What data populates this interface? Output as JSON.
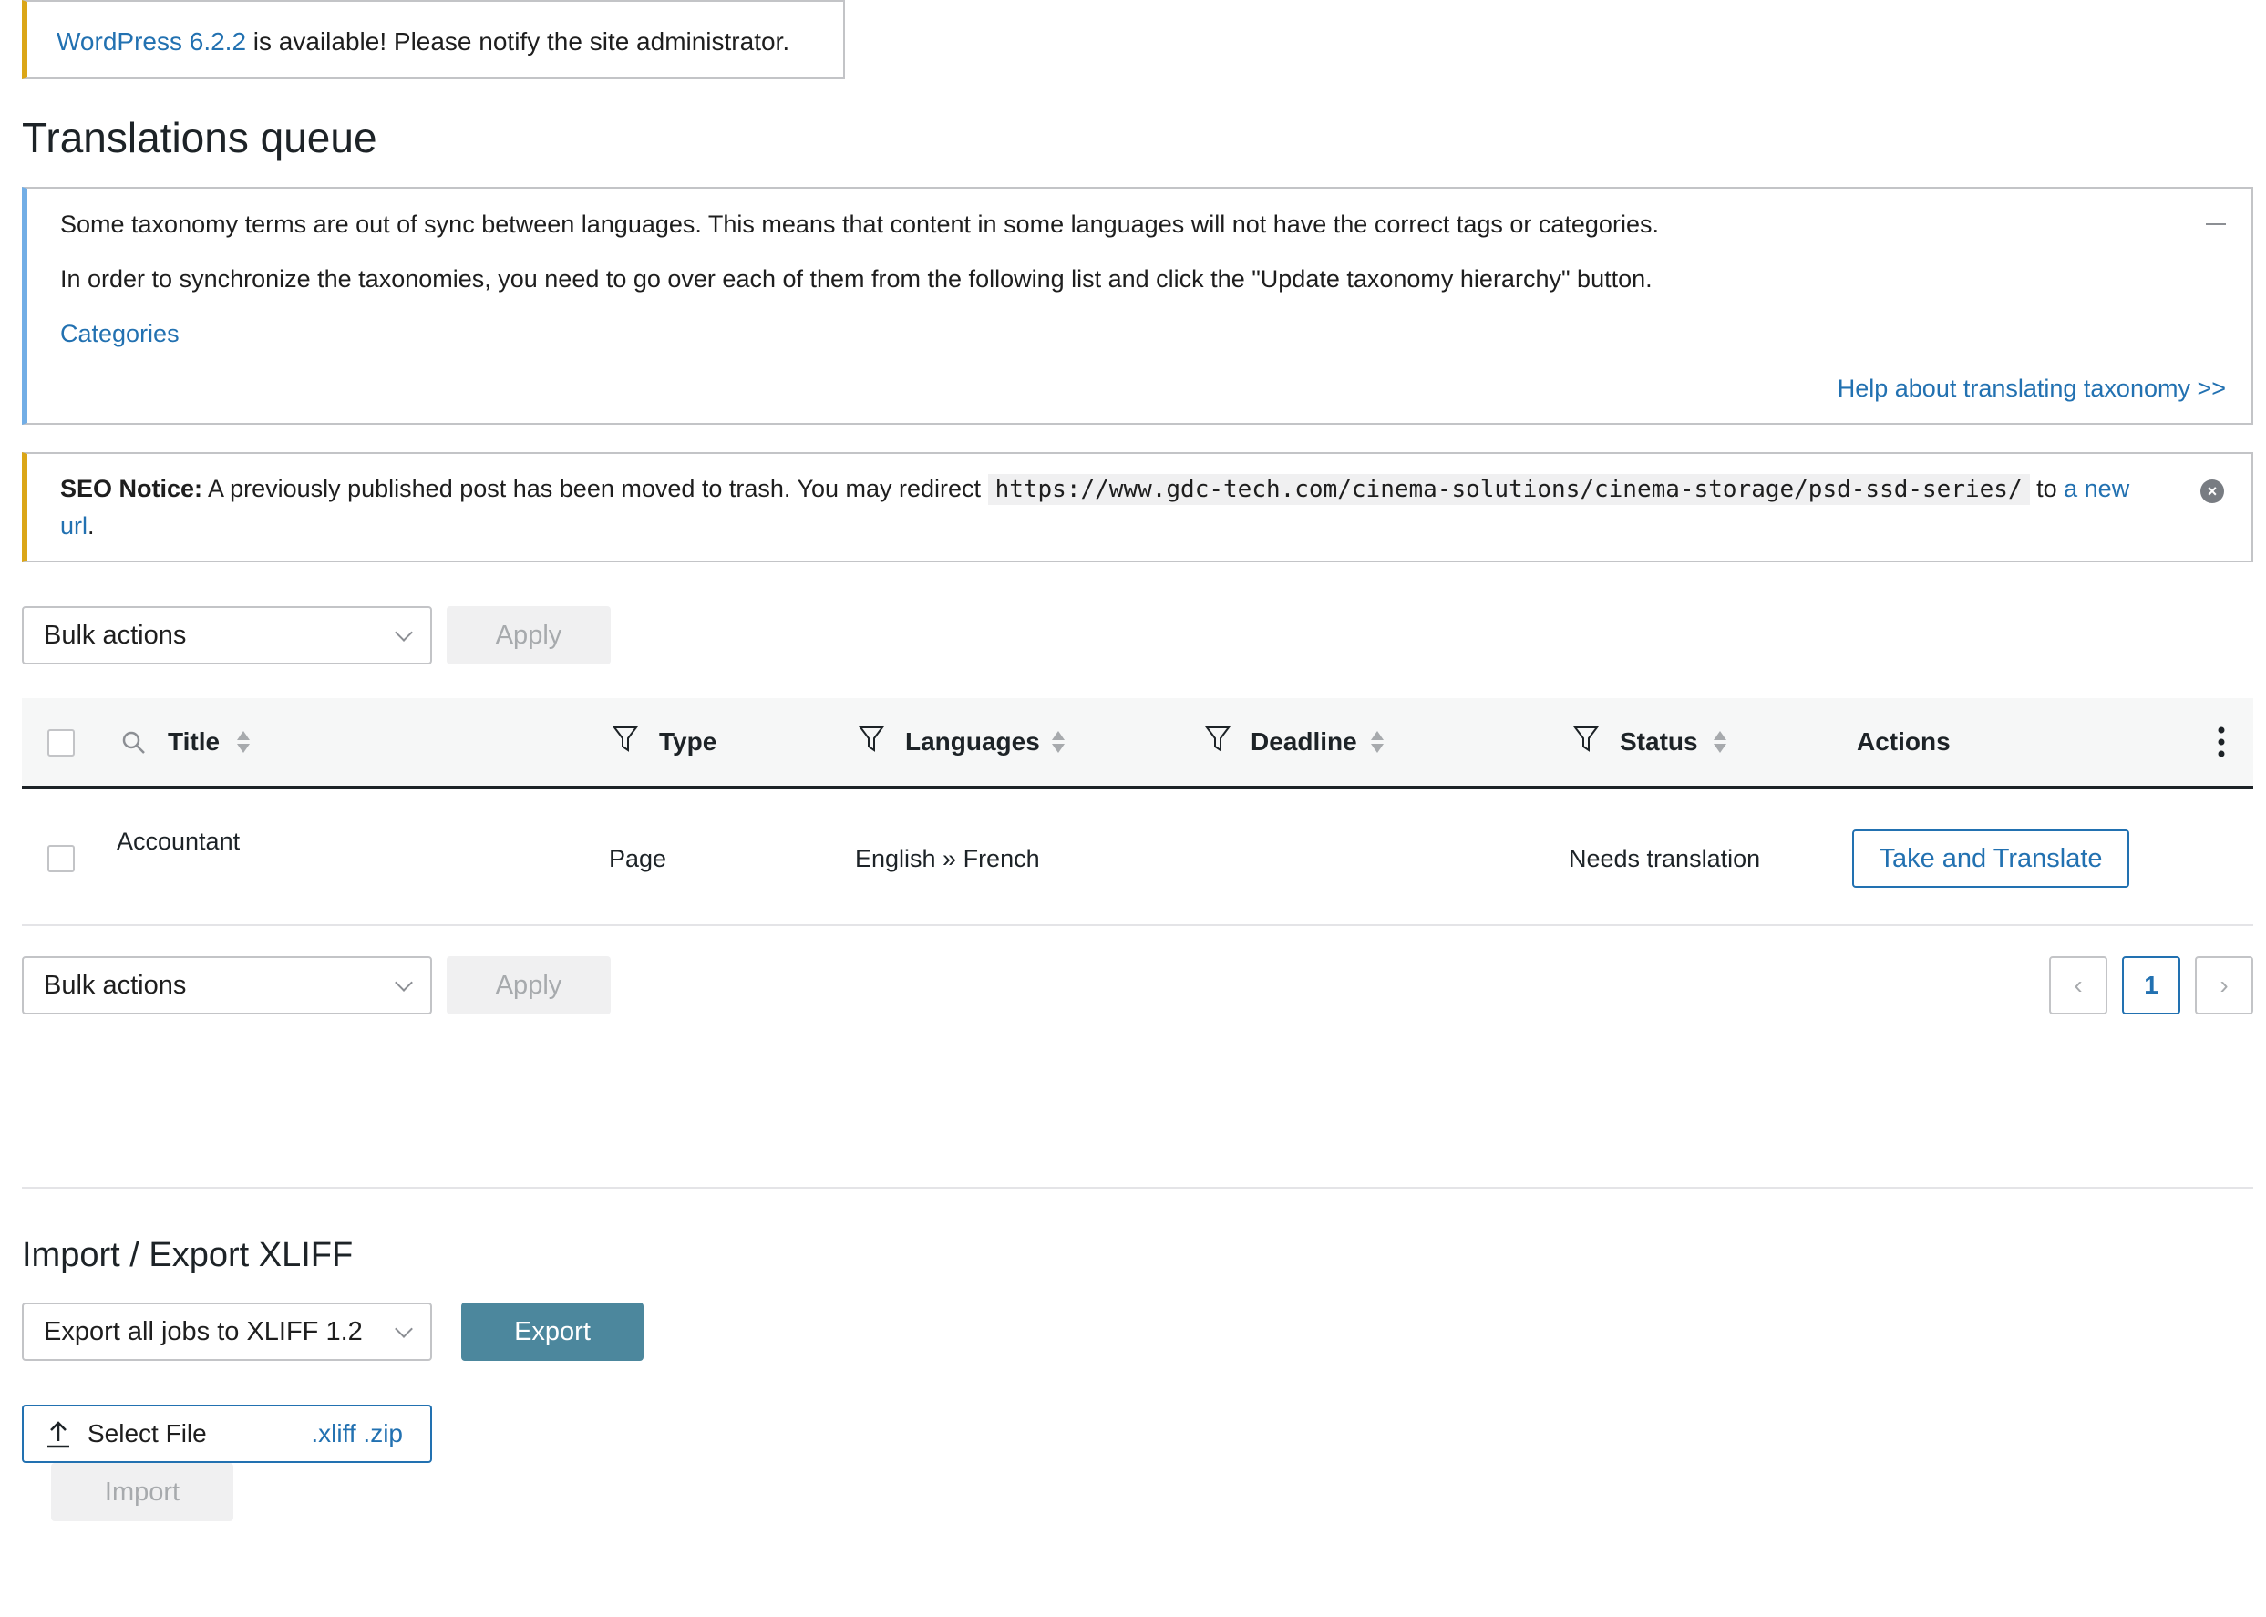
{
  "update_notice": {
    "link": "WordPress 6.2.2",
    "text": " is available! Please notify the site administrator."
  },
  "page_title": "Translations queue",
  "taxonomy_notice": {
    "line1": "Some taxonomy terms are out of sync between languages. This means that content in some languages will not have the correct tags or categories.",
    "line2": "In order to synchronize the taxonomies, you need to go over each of them from the following list and click the \"Update taxonomy hierarchy\" button.",
    "categories_link": "Categories",
    "help_link": "Help about translating taxonomy >>"
  },
  "seo_notice": {
    "label": "SEO Notice:",
    "text": " A previously published post has been moved to trash. You may redirect ",
    "url": "https://www.gdc-tech.com/cinema-solutions/cinema-storage/psd-ssd-series/",
    "to": " to ",
    "link": "a new url",
    "end": "."
  },
  "bulk_top": {
    "select": "Bulk actions",
    "apply": "Apply"
  },
  "bulk_bottom": {
    "select": "Bulk actions",
    "apply": "Apply"
  },
  "table": {
    "headers": {
      "title": "Title",
      "type": "Type",
      "languages": "Languages",
      "deadline": "Deadline",
      "status": "Status",
      "actions": "Actions"
    },
    "rows": [
      {
        "title": "Accountant",
        "type": "Page",
        "languages": "English » French",
        "deadline": "",
        "status": "Needs translation",
        "action": "Take and Translate"
      }
    ]
  },
  "pagination": {
    "prev": "‹",
    "current": "1",
    "next": "›"
  },
  "import_export": {
    "title": "Import / Export XLIFF",
    "export_select": "Export all jobs to XLIFF 1.2",
    "export_button": "Export",
    "select_file": "Select File",
    "file_ext": ".xliff .zip",
    "import_button": "Import"
  },
  "colors": {
    "link": "#2271b1",
    "warning_border": "#dba617",
    "info_border": "#72aee6",
    "primary_button": "#4c879d"
  }
}
